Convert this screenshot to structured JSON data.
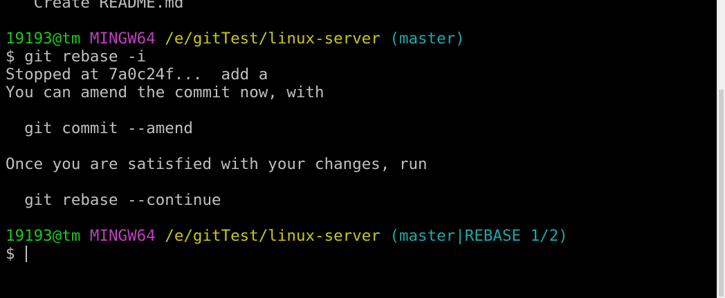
{
  "terminal": {
    "line_top": "   Create README.md",
    "prompt1": {
      "user": "19193@tm",
      "system": "MINGW64",
      "path": "/e/gitTest/linux-server",
      "branch": "(master)"
    },
    "command": "$ git rebase -i",
    "output": {
      "stopped": "Stopped at 7a0c24f...  add a",
      "amend_hint": "You can amend the commit now, with",
      "amend_cmd": "  git commit --amend",
      "continue_hint": "Once you are satisfied with your changes, run",
      "continue_cmd": "  git rebase --continue"
    },
    "prompt2": {
      "user": "19193@tm",
      "system": "MINGW64",
      "path": "/e/gitTest/linux-server",
      "branch": "(master|REBASE 1/2)"
    },
    "input_prompt": "$ ",
    "input_value": ""
  },
  "colors": {
    "background": "#000000",
    "text": "#c0c0c0",
    "user": "#1cc81c",
    "system": "#bf3fbf",
    "path": "#c8c819",
    "branch": "#1fa8a8"
  }
}
